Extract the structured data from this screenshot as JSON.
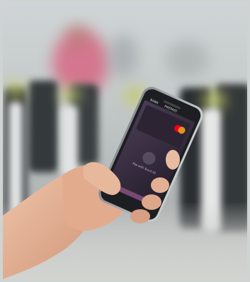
{
  "phone_screen": {
    "header_left": "BANK",
    "header_right": "PREPAID",
    "card_prompt": "Pay with Touch ID"
  },
  "colors": {
    "background_blur": "#c5cacb",
    "phone_body": "#1d1e22",
    "screen_bg": "#3b3042",
    "card_accent": "#eb001b",
    "card_accent_2": "#f79e1b",
    "skin": "#e6b499"
  }
}
